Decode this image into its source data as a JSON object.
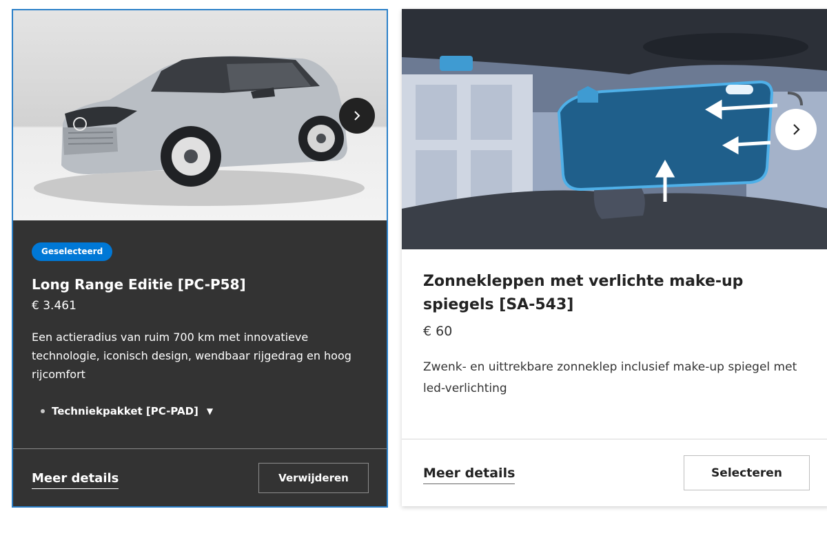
{
  "cards": [
    {
      "badge": "Geselecteerd",
      "title": "Long Range Editie [PC-P58]",
      "price": "€ 3.461",
      "description": "Een actieradius van ruim 700 km met innovatieve technologie, iconisch design, wendbaar rijgedrag en hoog rijcomfort",
      "package": "Techniekpakket [PC-PAD]",
      "details_label": "Meer details",
      "action_label": "Verwijderen",
      "image_icon": "car-photo",
      "next_icon": "chevron-right-icon",
      "selected": true
    },
    {
      "title": "Zonnekleppen met verlichte make-up spiegels [SA-543]",
      "price": "€ 60",
      "description": "Zwenk- en uittrekbare zonneklep inclusief make-up spiegel met led-verlichting",
      "details_label": "Meer details",
      "action_label": "Selecteren",
      "image_icon": "sun-visor-illustration",
      "next_icon": "chevron-right-icon",
      "selected": false
    }
  ],
  "colors": {
    "selected_border": "#2a7fc8",
    "badge": "#0078d6",
    "dark_card": "#333333",
    "visor": "#1f5f8b"
  }
}
